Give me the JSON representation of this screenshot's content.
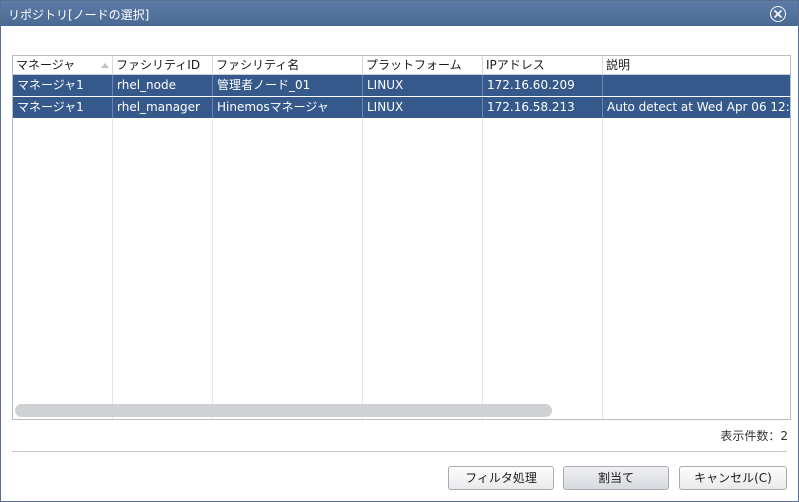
{
  "dialog": {
    "title": "リポジトリ[ノードの選択]"
  },
  "table": {
    "columns": [
      "マネージャ",
      "ファシリティID",
      "ファシリティ名",
      "プラットフォーム",
      "IPアドレス",
      "説明"
    ],
    "rows": [
      [
        "マネージャ1",
        "rhel_node",
        "管理者ノード_01",
        "LINUX",
        "172.16.60.209",
        ""
      ],
      [
        "マネージャ1",
        "rhel_manager",
        "Hinemosマネージャ",
        "LINUX",
        "172.16.58.213",
        "Auto detect at Wed Apr 06 12:"
      ]
    ],
    "selected_color": "#36598c"
  },
  "footer": {
    "count_label": "表示件数：2"
  },
  "buttons": {
    "filter": "フィルタ処理",
    "assign": "割当て",
    "cancel": "キャンセル(C)"
  }
}
